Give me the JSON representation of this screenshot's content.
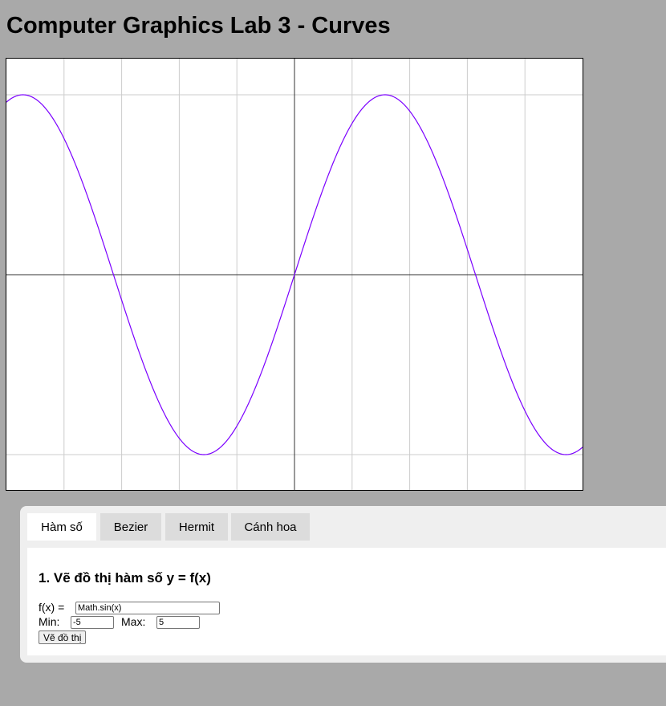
{
  "page": {
    "title": "Computer Graphics Lab 3 - Curves"
  },
  "tabs": [
    {
      "label": "Hàm số",
      "active": true
    },
    {
      "label": "Bezier",
      "active": false
    },
    {
      "label": "Hermit",
      "active": false
    },
    {
      "label": "Cánh hoa",
      "active": false
    }
  ],
  "function_panel": {
    "heading": "1. Vẽ đồ thị hàm số y = f(x)",
    "fx_label": "f(x) =",
    "fx_value": "Math.sin(x)",
    "min_label": "Min:",
    "min_value": "-5",
    "max_label": "Max:",
    "max_value": "5",
    "draw_button": "Vẽ đồ thị"
  },
  "plot": {
    "curve_color": "#7b00ff",
    "grid_color": "#cccccc",
    "axis_color": "#333333"
  }
}
